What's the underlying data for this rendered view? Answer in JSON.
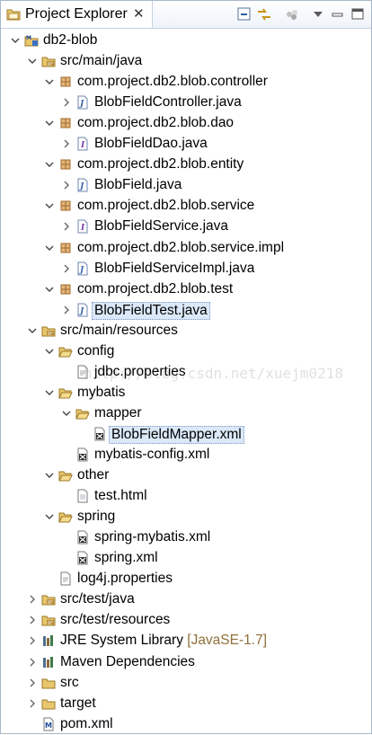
{
  "view": {
    "title": "Project Explorer",
    "close_glyph": "✕",
    "toolbar": [
      "collapse-all-icon",
      "link-with-editor-icon",
      "view-menu-dots-icon",
      "view-menu-icon",
      "minimize-icon",
      "maximize-icon"
    ]
  },
  "watermark": "http://blog.csdn.net/xuejm0218",
  "tree": [
    {
      "depth": 0,
      "arrow": "open",
      "icon": "maven-project",
      "label": "db2-blob"
    },
    {
      "depth": 1,
      "arrow": "open",
      "icon": "source-folder",
      "label": "src/main/java"
    },
    {
      "depth": 2,
      "arrow": "open",
      "icon": "package",
      "label": "com.project.db2.blob.controller"
    },
    {
      "depth": 3,
      "arrow": "closed",
      "icon": "java-file",
      "label": "BlobFieldController.java"
    },
    {
      "depth": 2,
      "arrow": "open",
      "icon": "package",
      "label": "com.project.db2.blob.dao"
    },
    {
      "depth": 3,
      "arrow": "closed",
      "icon": "java-interface",
      "label": "BlobFieldDao.java"
    },
    {
      "depth": 2,
      "arrow": "open",
      "icon": "package",
      "label": "com.project.db2.blob.entity"
    },
    {
      "depth": 3,
      "arrow": "closed",
      "icon": "java-file",
      "label": "BlobField.java"
    },
    {
      "depth": 2,
      "arrow": "open",
      "icon": "package",
      "label": "com.project.db2.blob.service"
    },
    {
      "depth": 3,
      "arrow": "closed",
      "icon": "java-interface",
      "label": "BlobFieldService.java"
    },
    {
      "depth": 2,
      "arrow": "open",
      "icon": "package",
      "label": "com.project.db2.blob.service.impl"
    },
    {
      "depth": 3,
      "arrow": "closed",
      "icon": "java-file",
      "label": "BlobFieldServiceImpl.java"
    },
    {
      "depth": 2,
      "arrow": "open",
      "icon": "package",
      "label": "com.project.db2.blob.test"
    },
    {
      "depth": 3,
      "arrow": "closed",
      "icon": "java-file",
      "label": "BlobFieldTest.java",
      "selected": true
    },
    {
      "depth": 1,
      "arrow": "open",
      "icon": "source-folder",
      "label": "src/main/resources"
    },
    {
      "depth": 2,
      "arrow": "open",
      "icon": "folder-open",
      "label": "config"
    },
    {
      "depth": 3,
      "arrow": "none",
      "icon": "properties-file",
      "label": "jdbc.properties"
    },
    {
      "depth": 2,
      "arrow": "open",
      "icon": "folder-open",
      "label": "mybatis"
    },
    {
      "depth": 3,
      "arrow": "open",
      "icon": "folder-open",
      "label": "mapper"
    },
    {
      "depth": 4,
      "arrow": "none",
      "icon": "xml-file",
      "label": "BlobFieldMapper.xml",
      "selected": true
    },
    {
      "depth": 3,
      "arrow": "none",
      "icon": "xml-file",
      "label": "mybatis-config.xml"
    },
    {
      "depth": 2,
      "arrow": "open",
      "icon": "folder-open",
      "label": "other"
    },
    {
      "depth": 3,
      "arrow": "none",
      "icon": "html-file",
      "label": "test.html"
    },
    {
      "depth": 2,
      "arrow": "open",
      "icon": "folder-open",
      "label": "spring"
    },
    {
      "depth": 3,
      "arrow": "none",
      "icon": "xml-file",
      "label": "spring-mybatis.xml"
    },
    {
      "depth": 3,
      "arrow": "none",
      "icon": "xml-file",
      "label": "spring.xml"
    },
    {
      "depth": 2,
      "arrow": "none",
      "icon": "properties-file",
      "label": "log4j.properties"
    },
    {
      "depth": 1,
      "arrow": "closed",
      "icon": "source-folder",
      "label": "src/test/java"
    },
    {
      "depth": 1,
      "arrow": "closed",
      "icon": "source-folder",
      "label": "src/test/resources"
    },
    {
      "depth": 1,
      "arrow": "closed",
      "icon": "library",
      "label": "JRE System Library",
      "decoration": "[JavaSE-1.7]"
    },
    {
      "depth": 1,
      "arrow": "closed",
      "icon": "library",
      "label": "Maven Dependencies"
    },
    {
      "depth": 1,
      "arrow": "closed",
      "icon": "folder-closed",
      "label": "src"
    },
    {
      "depth": 1,
      "arrow": "closed",
      "icon": "folder-closed",
      "label": "target"
    },
    {
      "depth": 1,
      "arrow": "none",
      "icon": "maven-pom",
      "label": "pom.xml"
    }
  ]
}
